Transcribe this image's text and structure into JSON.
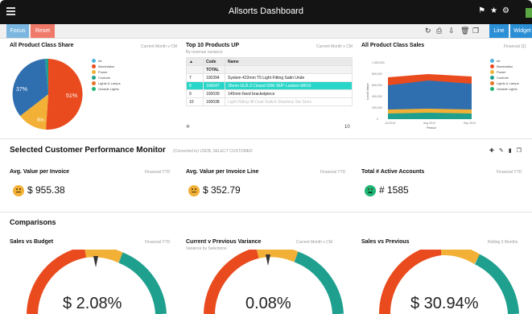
{
  "window": {
    "title": "Allsorts Dashboard"
  },
  "toolbar": {
    "focus_label": "Focus",
    "reset_label": "Reset",
    "line_label": "Line",
    "widget_label": "Widget"
  },
  "colors": {
    "red": "#e94b1e",
    "blue": "#2f6fb0",
    "yellow": "#f2b136",
    "teal": "#1fa08f",
    "orange": "#e8722a",
    "green": "#1fb577",
    "cyan": "#27d6c8",
    "lightblue": "#4fb3df"
  },
  "pie_panel": {
    "title": "All Product Class Share",
    "filter": "Current Month v CM",
    "legend": [
      "##",
      "Illumination",
      "Power",
      "Controls",
      "Lights & Lamps",
      "Outside Lights"
    ],
    "labels": {
      "blue": "37%",
      "red": "51%",
      "yellow": "9%"
    }
  },
  "table_panel": {
    "title": "Top 10 Products UP",
    "subtitle": "By revenue variance",
    "filter": "Current Month v CM",
    "header": {
      "code": "Code",
      "name": "Name"
    },
    "total_label": "TOTAL",
    "rows": [
      {
        "idx": "7",
        "code": "100394",
        "name": "System 422mm T5 Light Fitting Satin Unde"
      },
      {
        "idx": "8",
        "code": "100047",
        "name": "35mm GU5.3 Closed 50W 36Â° Lantern MR16"
      },
      {
        "idx": "9",
        "code": "100039",
        "name": "145mm fixed bracketpiece"
      },
      {
        "idx": "10",
        "code": "100038",
        "name": "Light Fitting 4ft Dual Switch Stainless Ste Sens"
      }
    ],
    "page_count": "10"
  },
  "area_panel": {
    "title": "All Product Class Sales",
    "filter": "Financial Q1",
    "legend": [
      "##",
      "Illumination",
      "Power",
      "Controls",
      "Lights & Lamps",
      "Outside Lights"
    ],
    "xlabel": "Period",
    "ylabel": "Local Value",
    "x_ticks": [
      "Jul 2014",
      "Aug 2014",
      "Sep 2014"
    ],
    "y_ticks": [
      "1,000,000",
      "800,000",
      "600,000",
      "400,000",
      "200,000",
      "0"
    ]
  },
  "customer_section": {
    "title": "Selected Customer Performance Monitor",
    "subtitle": "(Converted to) USD$, SELECT CUSTOMER",
    "metrics": [
      {
        "label": "Avg. Value per Invoice",
        "period": "Financial YTD",
        "value": "$ 955.38"
      },
      {
        "label": "Avg. Value per Invoice Line",
        "period": "Financial YTD",
        "value": "$ 352.79"
      },
      {
        "label": "Total # Active Accounts",
        "period": "Financial YTD",
        "value": "# 1585"
      }
    ]
  },
  "comparisons": {
    "title": "Comparisons",
    "items": [
      {
        "label": "Sales vs Budget",
        "period": "Financial YTD",
        "subtitle": "",
        "value": "$ 2.08%"
      },
      {
        "label": "Current v Previous Variance",
        "period": "Current Month v CM",
        "subtitle": "Variance by Selections",
        "value": "0.08%"
      },
      {
        "label": "Sales vs Previous",
        "period": "Rolling 3 Months",
        "subtitle": "",
        "value": "$ 30.94%"
      }
    ]
  }
}
